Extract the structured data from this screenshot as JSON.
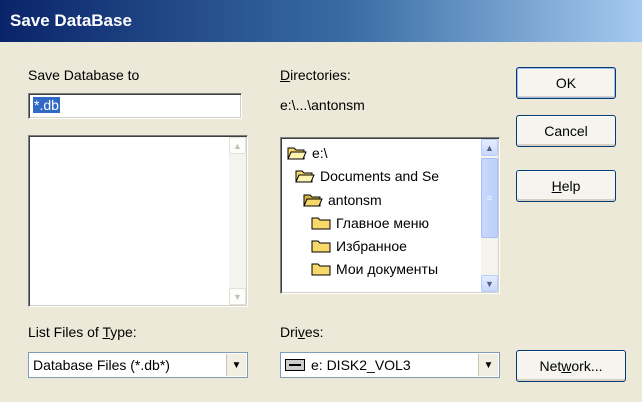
{
  "window": {
    "title": "Save DataBase"
  },
  "save_to": {
    "label": "Save Database to",
    "value": "*.db"
  },
  "directories": {
    "label": "Directories:",
    "current_path": "e:\\...\\antonsm",
    "tree": [
      {
        "name": "e:\\",
        "state": "open"
      },
      {
        "name": "Documents and Se",
        "state": "open"
      },
      {
        "name": "antonsm",
        "state": "open-selected"
      },
      {
        "name": "Главное меню",
        "state": "closed"
      },
      {
        "name": "Избранное",
        "state": "closed"
      },
      {
        "name": "Мои документы",
        "state": "closed"
      }
    ]
  },
  "buttons": {
    "ok": "OK",
    "cancel": "Cancel",
    "help": "Help",
    "network": "Network..."
  },
  "file_type": {
    "label": "List Files of Type:",
    "value": "Database Files (*.db*)"
  },
  "drives": {
    "label": "Drives:",
    "value": "e: DISK2_VOL3"
  },
  "colors": {
    "title_bar": "#0a246a",
    "dialog_bg": "#ece9d8",
    "selection": "#316ac5"
  },
  "icons": [
    "folder-open-icon",
    "folder-closed-icon",
    "drive-icon",
    "scroll-up-icon",
    "scroll-down-icon",
    "dropdown-arrow-icon"
  ]
}
